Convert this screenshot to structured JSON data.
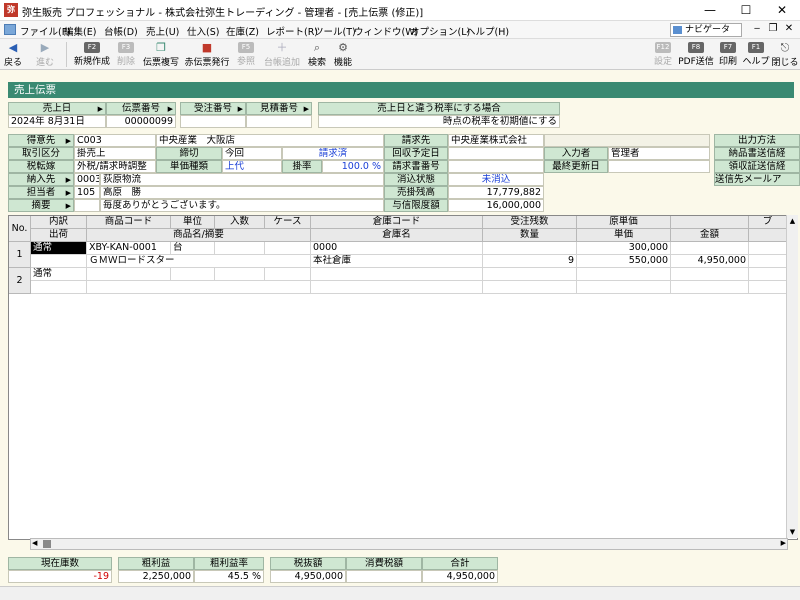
{
  "window": {
    "icon_label": "弥",
    "title": "弥生販売 プロフェッショナル - 株式会社弥生トレーディング - 管理者 - [売上伝票 (修正)]",
    "min": "—",
    "max": "☐",
    "close": "✕"
  },
  "menu": {
    "items": [
      "ファイル(F)",
      "編集(E)",
      "台帳(D)",
      "売上(U)",
      "仕入(S)",
      "在庫(Z)",
      "レポート(R)",
      "ツール(T)",
      "ウィンドウ(W)",
      "オプション(L)",
      "ヘルプ(H)"
    ],
    "navigator": "ナビゲータ",
    "mdi_min": "‒",
    "mdi_restore": "❐",
    "mdi_close": "✕"
  },
  "toolbar": {
    "back": "戻る",
    "forward": "進む",
    "new": "新規作成",
    "delete": "削除",
    "copy_slip": "伝票複写",
    "red_slip": "赤伝票発行",
    "reference": "参照",
    "ledger_add": "台帳追加",
    "search": "検索",
    "function": "機能",
    "f2": "F2",
    "f3": "F3",
    "f5": "F5",
    "f6": "F6",
    "f8": "F8",
    "f9": "F9",
    "settings": "設定",
    "pdf": "PDF送信",
    "print": "印刷",
    "help": "ヘルプ",
    "close": "閉じる",
    "f12": "F12",
    "f7": "F7",
    "f1": "F1",
    "f8b": "F8"
  },
  "form": {
    "title": "売上伝票",
    "header": {
      "sales_date_label": "売上日",
      "sales_date": "2024年 8月31日",
      "slip_no_label": "伝票番号",
      "slip_no": "00000099",
      "order_no_label": "受注番号",
      "order_no": "",
      "estimate_no_label": "見積番号",
      "estimate_no": "",
      "tax_rate_label": "売上日と違う税率にする場合",
      "tax_rate_value": "時点の税率を初期値にする"
    },
    "customer": {
      "customer_label": "得意先",
      "customer_code": "C003",
      "customer_name": "中央産業　大阪店",
      "billing_label": "請求先",
      "billing_name": "中央産業株式会社",
      "deal_type_label": "取引区分",
      "deal_type": "掛売上",
      "cutoff_label": "締切",
      "cutoff": "今回",
      "billed": "請求済",
      "collect_date_label": "回収予定日",
      "collect_date": "",
      "entry_user_label": "入力者",
      "entry_user": "管理者",
      "tax_type_label": "税転嫁",
      "tax_type": "外税/請求時調整",
      "price_type_label": "単価種類",
      "price_type": "上代",
      "rate_label": "掛率",
      "rate": "100.0 %",
      "invoice_no_label": "請求書番号",
      "invoice_no": "",
      "last_update_label": "最終更新日",
      "last_update": "",
      "delivery_label": "納入先",
      "delivery_code": "0003",
      "delivery_name": "荻原物流",
      "clear_status_label": "消込状態",
      "clear_status": "未消込",
      "staff_label": "担当者",
      "staff_code": "105",
      "staff_name": "高原　勝",
      "ar_balance_label": "売掛残高",
      "ar_balance": "17,779,882",
      "summary_label": "摘要",
      "summary": "毎度ありがとうございます。",
      "credit_label": "与信限度額",
      "credit": "16,000,000",
      "output_method_label": "出力方法",
      "delivery_doc_label": "納品書送信経",
      "receipt_doc_label": "領収証送信経",
      "mail_label": "送信先メールア"
    }
  },
  "grid": {
    "headers_row1": {
      "no": "No.",
      "type": "内訳",
      "item_code": "商品コード",
      "unit": "単位",
      "qty_per": "入数",
      "case": "ケース",
      "warehouse_code": "倉庫コード",
      "order_balance": "受注残数",
      "cost_price": "原単価",
      "bu": "ブ"
    },
    "headers_row2": {
      "ship": "出荷",
      "item_name": "商品名/摘要",
      "warehouse_name": "倉庫名",
      "qty": "数量",
      "unit_price": "単価",
      "amount": "金額"
    },
    "rows": [
      {
        "no": "1",
        "type": "通常",
        "item_code": "XBY-KAN-0001",
        "unit": "台",
        "warehouse_code": "0000",
        "item_name": "ＧＭＷロードスター",
        "warehouse_name": "本社倉庫",
        "qty": "9",
        "cost_price": "300,000",
        "unit_price": "550,000",
        "amount": "4,950,000"
      },
      {
        "no": "2",
        "type": "通常",
        "item_code": "",
        "unit": "",
        "warehouse_code": "",
        "item_name": "",
        "warehouse_name": "",
        "qty": "",
        "cost_price": "",
        "unit_price": "",
        "amount": ""
      }
    ]
  },
  "totals": {
    "stock_label": "現在庫数",
    "stock": "-19",
    "gross_profit_label": "粗利益",
    "gross_profit": "2,250,000",
    "gross_margin_label": "粗利益率",
    "gross_margin": "45.5 %",
    "pretax_label": "税抜額",
    "pretax": "4,950,000",
    "tax_label": "消費税額",
    "tax": "",
    "total_label": "合計",
    "total": "4,950,000"
  },
  "colors": {
    "form_title_bg": "#3a8a72",
    "label_bg": "#cfe7d2",
    "content_bg": "#fbf9ea",
    "link_blue": "#1a3fd6",
    "negative_red": "#d00000"
  }
}
